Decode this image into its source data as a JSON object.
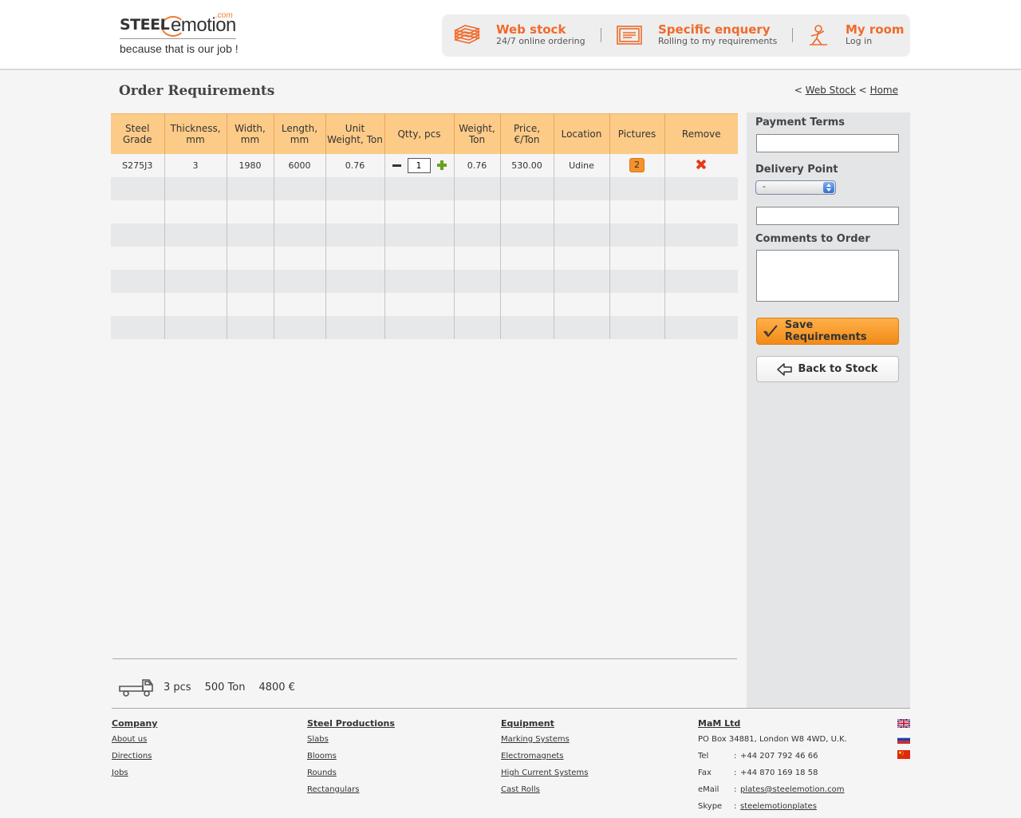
{
  "logo": {
    "steel": "STEEL",
    "emotion": "emotion",
    "com": ".com",
    "tagline": "because that is our job !"
  },
  "topnav": {
    "web_stock": {
      "title": "Web stock",
      "subtitle": "24/7 online ordering"
    },
    "specific_enquery": {
      "title": "Specific enquery",
      "subtitle": "Rolling to my requirements"
    },
    "my_room": {
      "title": "My room",
      "subtitle": "Log in"
    }
  },
  "page": {
    "title": "Order Requirements"
  },
  "breadcrumb": {
    "sep": "<",
    "web_stock": "Web Stock",
    "home": "Home"
  },
  "table": {
    "headers": [
      "Steel Grade",
      "Thickness, mm",
      "Width, mm",
      "Length, mm",
      "Unit Weight, Ton",
      "Qtty, pcs",
      "Weight, Ton",
      "Price, €/Ton",
      "Location",
      "Pictures",
      "Remove"
    ],
    "row": {
      "grade": "S275J3",
      "thickness": "3",
      "width": "1980",
      "length": "6000",
      "unit_weight": "0.76",
      "qty": "1",
      "weight": "0.76",
      "price": "530.00",
      "location": "Udine",
      "pictures": "2"
    },
    "empty_rows": 7
  },
  "summary": {
    "pcs": "3 pcs",
    "ton": "500 Ton",
    "eur": "4800 €"
  },
  "sidebar": {
    "payment_terms_label": "Payment Terms",
    "delivery_point_label": "Delivery Point",
    "delivery_select_value": "-",
    "comments_label": "Comments to Order",
    "save_button": "Save Requirements",
    "back_button": "Back to Stock"
  },
  "footer": {
    "company": {
      "heading": "Company",
      "links": [
        "About us",
        "Directions",
        "Jobs"
      ]
    },
    "steel_productions": {
      "heading": "Steel Productions",
      "links": [
        "Slabs",
        "Blooms",
        "Rounds",
        "Rectangulars"
      ]
    },
    "equipment": {
      "heading": "Equipment",
      "links": [
        "Marking Systems",
        "Electromagnets",
        "High Current Systems",
        "Cast Rolls"
      ]
    },
    "contact": {
      "heading": "MaM Ltd",
      "address": "PO Box 34881, London W8 4WD, U.K.",
      "tel_label": "Tel",
      "tel": "+44 207 792 46 66",
      "fax_label": "Fax",
      "fax": "+44 870 169 18 58",
      "email_label": "eMail",
      "email": "plates@steelemotion.com",
      "skype_label": "Skype",
      "skype": "steelemotionplates",
      "colon": ":"
    }
  },
  "colors": {
    "accent": "#f06a2a",
    "table_header": "#fdcb88",
    "sidebar_bg": "#e3e5e7"
  },
  "icons": {
    "flags": [
      "uk-flag-icon",
      "russia-flag-icon",
      "china-flag-icon"
    ]
  }
}
